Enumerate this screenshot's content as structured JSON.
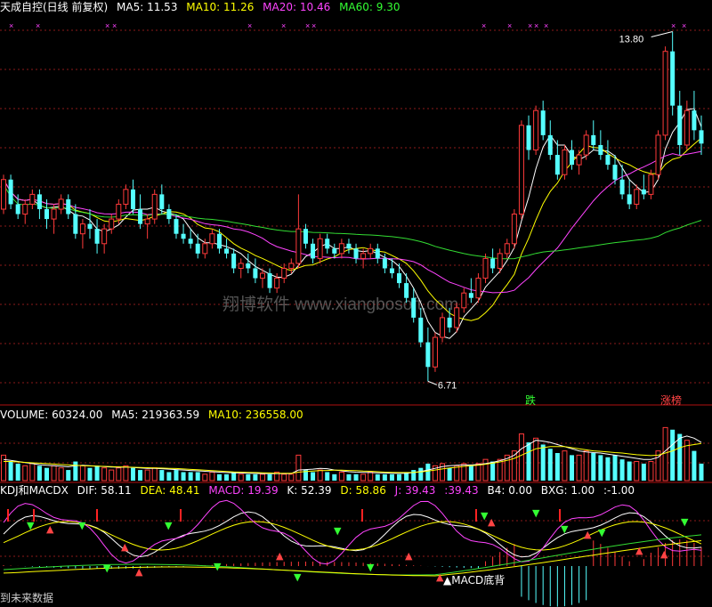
{
  "colors": {
    "up": "#ff3a3a",
    "down": "#55ffff",
    "ma5": "#ffffff",
    "ma10": "#ffff00",
    "ma20": "#ff44ff",
    "ma60": "#33dd33",
    "grid": "#8b1a1a",
    "axis": "#b01010",
    "label_green": "#33ff33",
    "label_magenta": "#ff44ff"
  },
  "price_panel": {
    "title": "天成自控(日线 前复权)",
    "ma5": {
      "label": "MA5:",
      "value": "11.53"
    },
    "ma10": {
      "label": "MA10:",
      "value": "11.26"
    },
    "ma20": {
      "label": "MA20:",
      "value": "10.46"
    },
    "ma60": {
      "label": "MA60:",
      "value": "9.30"
    },
    "high_label": "13.80",
    "low_label": "6.71",
    "watermark": "翔博软件 www.xiangbosoft.com",
    "tag_die": "跌",
    "tag_zhangbang": "涨榜"
  },
  "volume_panel": {
    "volume": {
      "label": "VOLUME:",
      "value": "60324.00"
    },
    "ma5": {
      "label": "MA5:",
      "value": "219363.59"
    },
    "ma10": {
      "label": "MA10:",
      "value": "236558.00"
    }
  },
  "indicator_panel": {
    "name": "KDJ和MACDX",
    "dif": {
      "label": "DIF:",
      "value": "58.11"
    },
    "dea": {
      "label": "DEA:",
      "value": "48.41"
    },
    "macd": {
      "label": "MACD:",
      "value": "19.39"
    },
    "k": {
      "label": "K:",
      "value": "52.39"
    },
    "d": {
      "label": "D:",
      "value": "58.86"
    },
    "j": {
      "label": "J:",
      "value": "39.43"
    },
    "j2": {
      "label": ":",
      "value": "39.43"
    },
    "b4": {
      "label": "B4:",
      "value": "0.00"
    },
    "bxg": {
      "label": "BXG:",
      "value": "1.00"
    },
    "extra": {
      "label": ":",
      "value": "-1.00"
    },
    "macd_label": "MACD底背",
    "bottom_text": "到未来数据"
  },
  "chart_data": {
    "type": "candlestick",
    "candles": [
      [
        10.2,
        10.9,
        10.1,
        10.8
      ],
      [
        10.8,
        10.9,
        10.2,
        10.3
      ],
      [
        10.3,
        10.5,
        10.0,
        10.1
      ],
      [
        10.1,
        10.4,
        9.9,
        10.3
      ],
      [
        10.3,
        10.6,
        10.2,
        10.5
      ],
      [
        10.5,
        10.6,
        10.0,
        10.2
      ],
      [
        10.2,
        10.4,
        9.8,
        10.0
      ],
      [
        10.0,
        10.3,
        9.7,
        10.2
      ],
      [
        10.2,
        10.5,
        10.1,
        10.4
      ],
      [
        10.4,
        10.5,
        10.0,
        10.1
      ],
      [
        10.1,
        10.3,
        9.6,
        9.7
      ],
      [
        9.7,
        10.0,
        9.4,
        9.9
      ],
      [
        9.9,
        10.2,
        9.6,
        9.8
      ],
      [
        9.8,
        10.0,
        9.3,
        9.5
      ],
      [
        9.5,
        9.9,
        9.3,
        9.8
      ],
      [
        9.8,
        10.1,
        9.7,
        10.0
      ],
      [
        10.0,
        10.4,
        9.9,
        10.3
      ],
      [
        10.3,
        10.7,
        10.2,
        10.6
      ],
      [
        10.6,
        10.8,
        10.1,
        10.2
      ],
      [
        10.2,
        10.5,
        9.8,
        9.9
      ],
      [
        9.9,
        10.1,
        9.6,
        10.0
      ],
      [
        10.0,
        10.6,
        9.9,
        10.5
      ],
      [
        10.5,
        10.7,
        10.1,
        10.2
      ],
      [
        10.2,
        10.3,
        9.9,
        10.0
      ],
      [
        10.0,
        10.1,
        9.6,
        9.7
      ],
      [
        9.7,
        9.9,
        9.5,
        9.6
      ],
      [
        9.6,
        9.8,
        9.4,
        9.5
      ],
      [
        9.5,
        9.7,
        9.2,
        9.3
      ],
      [
        9.3,
        9.6,
        9.2,
        9.5
      ],
      [
        9.5,
        9.8,
        9.4,
        9.7
      ],
      [
        9.7,
        9.8,
        9.3,
        9.4
      ],
      [
        9.4,
        9.6,
        9.2,
        9.3
      ],
      [
        9.3,
        9.4,
        8.9,
        9.0
      ],
      [
        9.0,
        9.2,
        8.8,
        9.1
      ],
      [
        9.1,
        9.3,
        8.9,
        9.0
      ],
      [
        9.0,
        9.2,
        8.7,
        8.8
      ],
      [
        8.8,
        9.0,
        8.6,
        8.9
      ],
      [
        8.9,
        9.0,
        8.5,
        8.6
      ],
      [
        8.6,
        8.9,
        8.5,
        8.8
      ],
      [
        8.8,
        9.1,
        8.7,
        9.0
      ],
      [
        9.0,
        9.2,
        8.9,
        9.1
      ],
      [
        9.1,
        10.5,
        9.0,
        9.8
      ],
      [
        9.8,
        9.9,
        9.4,
        9.5
      ],
      [
        9.5,
        9.6,
        9.1,
        9.2
      ],
      [
        9.2,
        9.7,
        9.1,
        9.6
      ],
      [
        9.6,
        9.7,
        9.3,
        9.4
      ],
      [
        9.4,
        9.5,
        9.2,
        9.3
      ],
      [
        9.3,
        9.6,
        9.2,
        9.5
      ],
      [
        9.5,
        9.6,
        9.3,
        9.4
      ],
      [
        9.4,
        9.5,
        9.1,
        9.2
      ],
      [
        9.2,
        9.4,
        9.0,
        9.3
      ],
      [
        9.3,
        9.5,
        9.2,
        9.4
      ],
      [
        9.4,
        9.5,
        9.1,
        9.2
      ],
      [
        9.2,
        9.3,
        8.9,
        9.0
      ],
      [
        9.0,
        9.2,
        8.8,
        8.9
      ],
      [
        8.9,
        9.1,
        8.6,
        8.7
      ],
      [
        8.7,
        8.9,
        8.3,
        8.4
      ],
      [
        8.4,
        8.6,
        7.9,
        8.0
      ],
      [
        8.0,
        8.2,
        7.4,
        7.5
      ],
      [
        7.5,
        7.8,
        6.71,
        7.0
      ],
      [
        7.0,
        7.7,
        6.9,
        7.6
      ],
      [
        7.6,
        8.1,
        7.5,
        8.0
      ],
      [
        8.0,
        8.2,
        7.7,
        7.8
      ],
      [
        7.8,
        8.3,
        7.7,
        8.2
      ],
      [
        8.2,
        8.6,
        8.1,
        8.5
      ],
      [
        8.5,
        8.8,
        8.3,
        8.4
      ],
      [
        8.4,
        8.9,
        8.3,
        8.8
      ],
      [
        8.8,
        9.3,
        8.7,
        9.2
      ],
      [
        9.2,
        9.4,
        8.9,
        9.0
      ],
      [
        9.0,
        9.4,
        8.9,
        9.3
      ],
      [
        9.3,
        9.6,
        9.2,
        9.5
      ],
      [
        9.5,
        10.2,
        9.4,
        10.1
      ],
      [
        10.1,
        12.0,
        10.0,
        11.9
      ],
      [
        11.9,
        12.1,
        11.2,
        11.4
      ],
      [
        11.4,
        12.3,
        11.3,
        12.2
      ],
      [
        12.2,
        12.4,
        11.6,
        11.7
      ],
      [
        11.7,
        12.0,
        11.2,
        11.3
      ],
      [
        11.3,
        11.6,
        10.8,
        10.9
      ],
      [
        10.9,
        11.5,
        10.8,
        11.4
      ],
      [
        11.4,
        11.6,
        11.0,
        11.1
      ],
      [
        11.1,
        11.4,
        10.9,
        11.3
      ],
      [
        11.3,
        11.8,
        11.2,
        11.7
      ],
      [
        11.7,
        12.0,
        11.4,
        11.5
      ],
      [
        11.5,
        11.8,
        11.2,
        11.3
      ],
      [
        11.3,
        11.6,
        11.0,
        11.1
      ],
      [
        11.1,
        11.3,
        10.7,
        10.8
      ],
      [
        10.8,
        11.1,
        10.4,
        10.5
      ],
      [
        10.5,
        10.8,
        10.2,
        10.3
      ],
      [
        10.3,
        10.7,
        10.2,
        10.6
      ],
      [
        10.6,
        10.9,
        10.4,
        10.5
      ],
      [
        10.5,
        11.0,
        10.4,
        10.9
      ],
      [
        10.9,
        11.8,
        10.8,
        11.7
      ],
      [
        11.7,
        13.5,
        11.6,
        13.4
      ],
      [
        13.4,
        13.8,
        12.1,
        12.3
      ],
      [
        12.3,
        12.6,
        11.3,
        11.5
      ],
      [
        11.5,
        12.4,
        11.4,
        12.2
      ],
      [
        12.2,
        12.6,
        11.6,
        11.8
      ],
      [
        11.8,
        12.1,
        11.3,
        11.53
      ]
    ],
    "volume": [
      12,
      9,
      8,
      7,
      8,
      7,
      6,
      7,
      6,
      5,
      9,
      7,
      6,
      7,
      6,
      5,
      6,
      7,
      6,
      5,
      5,
      6,
      5,
      4,
      5,
      4,
      4,
      4,
      3,
      4,
      3,
      3,
      4,
      3,
      3,
      3,
      3,
      3,
      4,
      3,
      3,
      12,
      5,
      4,
      5,
      4,
      3,
      4,
      3,
      3,
      3,
      4,
      3,
      3,
      3,
      3,
      4,
      5,
      6,
      8,
      7,
      8,
      6,
      7,
      8,
      7,
      8,
      10,
      9,
      10,
      12,
      14,
      22,
      18,
      20,
      17,
      15,
      13,
      14,
      12,
      12,
      14,
      13,
      12,
      11,
      12,
      10,
      9,
      9,
      8,
      9,
      14,
      25,
      24,
      22,
      19,
      14,
      8
    ],
    "volume_ma5": [
      10,
      9.5,
      9,
      8.5,
      8,
      7.5,
      7.2,
      7,
      6.8,
      6.5,
      7,
      7.2,
      7,
      6.8,
      6.6,
      6.4,
      6.3,
      6.4,
      6.2,
      6,
      5.8,
      5.8,
      5.6,
      5.4,
      5.2,
      5,
      4.8,
      4.6,
      4.4,
      4.2,
      4,
      3.8,
      3.7,
      3.6,
      3.5,
      3.4,
      3.3,
      3.3,
      3.3,
      3.3,
      3.3,
      5,
      5.2,
      5.4,
      5.8,
      5.6,
      5,
      4.6,
      4.2,
      4,
      3.9,
      3.8,
      3.7,
      3.6,
      3.5,
      3.4,
      3.5,
      3.8,
      4.3,
      5,
      5.8,
      6.6,
      7,
      7.2,
      7.4,
      7.4,
      7.6,
      8,
      8.6,
      9.4,
      10.4,
      12,
      15,
      17,
      19,
      18.6,
      18,
      17,
      16,
      15,
      14,
      13.5,
      13.2,
      13,
      12.5,
      12,
      11.5,
      11,
      10.5,
      10,
      10,
      11,
      14,
      17,
      20,
      21,
      20,
      18
    ],
    "volume_ma10": [
      9,
      9,
      8.8,
      8.6,
      8.4,
      8.2,
      8,
      7.8,
      7.6,
      7.4,
      7.2,
      7,
      6.9,
      6.8,
      6.7,
      6.6,
      6.5,
      6.4,
      6.3,
      6.2,
      6.1,
      6,
      5.9,
      5.8,
      5.7,
      5.5,
      5.3,
      5.1,
      4.9,
      4.7,
      4.5,
      4.3,
      4.1,
      4,
      3.9,
      3.8,
      3.7,
      3.6,
      3.5,
      3.5,
      3.5,
      4,
      4.3,
      4.5,
      4.7,
      4.8,
      4.9,
      4.9,
      4.8,
      4.7,
      4.5,
      4.4,
      4.2,
      4,
      3.9,
      3.8,
      3.8,
      3.9,
      4.1,
      4.5,
      5,
      5.5,
      6,
      6.3,
      6.7,
      7,
      7.3,
      7.7,
      8.2,
      8.8,
      9.5,
      10.5,
      12,
      13.5,
      15,
      15.5,
      16,
      16,
      16,
      15.5,
      15,
      14.5,
      14,
      13.8,
      13.5,
      13.2,
      13,
      12.6,
      12.2,
      12,
      11.8,
      12,
      13,
      14,
      15.5,
      16.5,
      17,
      17.5
    ]
  }
}
